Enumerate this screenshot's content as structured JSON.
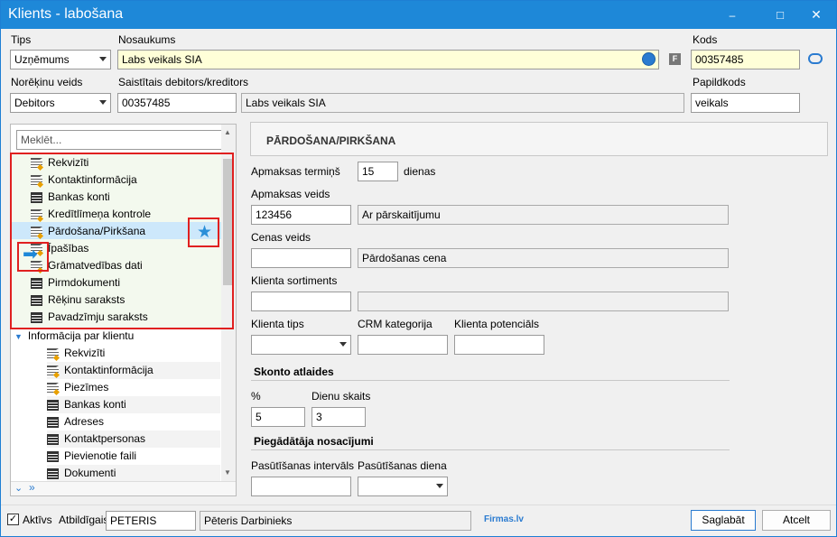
{
  "window": {
    "title": "Klients - labošana",
    "minimize": "–",
    "maximize": "□",
    "close": "✕"
  },
  "header": {
    "tips_label": "Tips",
    "tips_value": "Uzņēmums",
    "name_label": "Nosaukums",
    "name_value": "Labs veikals SIA",
    "f_badge": "F",
    "kods_label": "Kods",
    "kods_value": "00357485",
    "noreķinu_label": "Norēķinu veids",
    "noreķinu_value": "Debitors",
    "saistitais_label": "Saistītais debitors/kreditors",
    "saistitais_code": "00357485",
    "saistitais_name": "Labs veikals SIA",
    "papildkods_label": "Papildkods",
    "papildkods_value": "veikals"
  },
  "search": {
    "placeholder": "Meklēt..."
  },
  "tree": {
    "items": [
      "Rekvizīti",
      "Kontaktinformācija",
      "Bankas konti",
      "Kredītlīmeņa kontrole",
      "Pārdošana/Pirkšana",
      "Īpašības",
      "Grāmatvedības dati",
      "Pirmdokumenti",
      "Rēķinu saraksts",
      "Pavadzīmju saraksts"
    ],
    "group_label": "Informācija par klientu",
    "sub_items": [
      "Rekvizīti",
      "Kontaktinformācija",
      "Piezīmes",
      "Bankas konti",
      "Adreses",
      "Kontaktpersonas",
      "Pievienotie faili",
      "Dokumenti"
    ]
  },
  "panel": {
    "title": "PĀRDOŠANA/PIRKŠANA",
    "apmaksas_termins_label": "Apmaksas termiņš",
    "apmaksas_termins_value": "15",
    "dienas": "dienas",
    "apmaksas_veids_label": "Apmaksas veids",
    "apmaksas_veids_code": "123456",
    "apmaksas_veids_name": "Ar pārskaitījumu",
    "cenas_veids_label": "Cenas veids",
    "cenas_veids_code": "",
    "cenas_veids_name": "Pārdošanas cena",
    "klienta_sortiments_label": "Klienta sortiments",
    "klienta_tips_label": "Klienta tips",
    "crm_label": "CRM kategorija",
    "potencials_label": "Klienta potenciāls",
    "skonto_title": "Skonto atlaides",
    "percent_label": "%",
    "percent_value": "5",
    "dienu_skaits_label": "Dienu skaits",
    "dienu_skaits_value": "3",
    "piegadataja_title": "Piegādātāja nosacījumi",
    "pasutisanas_intervals_label": "Pasūtīšanas intervāls",
    "pasutisanas_diena_label": "Pasūtīšanas diena"
  },
  "footer": {
    "aktivs_label": "Aktīvs",
    "atbildigais_label": "Atbildīgais",
    "atbildigais_code": "PETERIS",
    "atbildigais_name": "Pēteris Darbinieks",
    "firmas_link": "Firmas.lv",
    "save": "Saglabāt",
    "cancel": "Atcelt"
  },
  "colors": {
    "accent": "#1e88d8",
    "highlight_red": "#e02020",
    "selected_row": "#cde8fb",
    "tree_bg": "#f3f9ee"
  }
}
